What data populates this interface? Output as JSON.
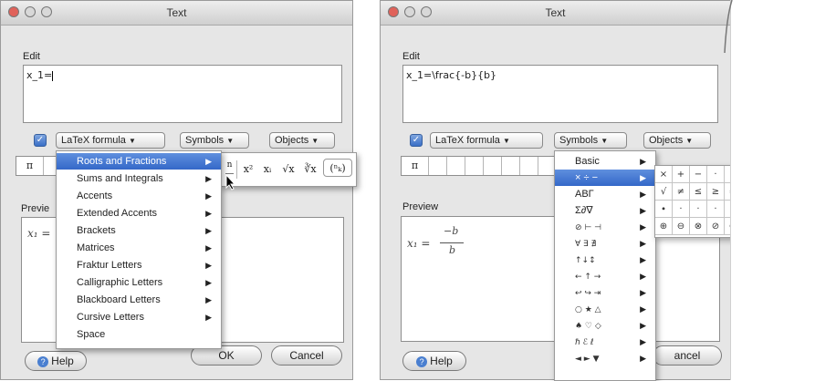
{
  "left": {
    "title": "Text",
    "edit_label": "Edit",
    "edit_value": "x_1=",
    "latex_label": "LaTeX formula",
    "symbols_label": "Symbols",
    "objects_label": "Objects",
    "palette_first": "π",
    "preview_label": "Previe",
    "preview_math": "x₁ =",
    "help_label": "Help",
    "ok_label": "OK",
    "cancel_label": "Cancel",
    "menu_items": [
      "Roots and Fractions",
      "Sums and Integrals",
      "Accents",
      "Extended Accents",
      "Brackets",
      "Matrices",
      "Fraktur Letters",
      "Calligraphic Letters",
      "Blackboard Letters",
      "Cursive Letters",
      "Space"
    ],
    "menu_selected": "Roots and Fractions",
    "submenu_symbols": [
      "x²",
      "xᵢ",
      "√x",
      "∛x",
      "(ⁿₖ)"
    ]
  },
  "right": {
    "title": "Text",
    "edit_label": "Edit",
    "edit_value": "x_1=\\frac{-b}{b}",
    "latex_label": "LaTeX formula",
    "symbols_label": "Symbols",
    "objects_label": "Objects",
    "palette_first": "π",
    "preview_label": "Preview",
    "preview_lhs": "x₁ =",
    "preview_num": "−b",
    "preview_den": "b",
    "help_label": "Help",
    "cancel_label": "ancel",
    "menu_items": [
      "Basic",
      "× ÷ −",
      "ΑΒΓ",
      "Σ∂∇",
      "⊘ ⊢ ⊣",
      "∀ ∃ ∄",
      "↑↓↕",
      "← ↑ →",
      "↩ ↪ ⇥",
      "○ ★ △",
      "♠ ♡ ◇",
      "ℏ ℰ ℓ",
      "◄ ► ▼"
    ],
    "menu_selected": "× ÷ −",
    "grid_rows": [
      [
        "×",
        "+",
        "−",
        "·",
        "·",
        "·",
        "·",
        "±",
        "∓"
      ],
      [
        "√",
        "≠",
        "≤",
        "≥",
        "≈",
        "−",
        "−",
        "−",
        "−"
      ],
      [
        "∙",
        "·",
        "·",
        "·",
        "·",
        "⊥",
        "∥",
        "∤",
        ""
      ],
      [
        "⊕",
        "⊖",
        "⊗",
        "⊘",
        "⊙",
        "",
        "",
        "",
        ""
      ]
    ]
  }
}
